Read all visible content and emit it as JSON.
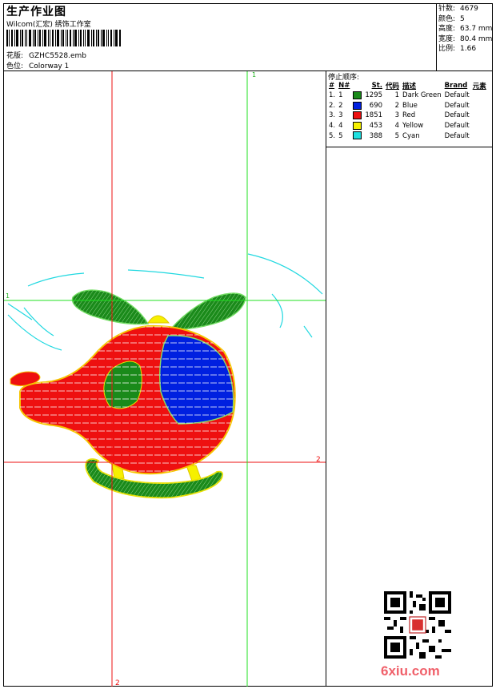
{
  "header": {
    "title": "生产作业图",
    "studio": "Wilcom(汇宏) 绣饰工作室",
    "design_label": "花版:",
    "design_value": "GZHC5528.emb",
    "colorway_label": "色位:",
    "colorway_value": "Colorway 1"
  },
  "stats": {
    "stitches_label": "针数:",
    "stitches_value": "4679",
    "colors_label": "颜色:",
    "colors_value": "5",
    "height_label": "高度:",
    "height_value": "63.7 mm",
    "width_label": "宽度:",
    "width_value": "80.4 mm",
    "ratio_label": "比例:",
    "ratio_value": "1.66"
  },
  "stop_sequence": {
    "title": "停止顺序:",
    "columns": [
      "#",
      "N#",
      "St.",
      "代码",
      "描述",
      "Brand",
      "元素"
    ],
    "rows": [
      {
        "idx": "1.",
        "n": "1",
        "color": "#1a8a1a",
        "st": "1295",
        "code": "1",
        "desc": "Dark Green",
        "brand": "Default"
      },
      {
        "idx": "2.",
        "n": "2",
        "color": "#0020e0",
        "st": "690",
        "code": "2",
        "desc": "Blue",
        "brand": "Default"
      },
      {
        "idx": "3.",
        "n": "3",
        "color": "#ee1010",
        "st": "1851",
        "code": "3",
        "desc": "Red",
        "brand": "Default"
      },
      {
        "idx": "4.",
        "n": "4",
        "color": "#f6f000",
        "st": "453",
        "code": "4",
        "desc": "Yellow",
        "brand": "Default"
      },
      {
        "idx": "5.",
        "n": "5",
        "color": "#20e0e0",
        "st": "388",
        "code": "5",
        "desc": "Cyan",
        "brand": "Default"
      }
    ]
  },
  "design": {
    "marker_green_top": "1",
    "marker_green_left": "1",
    "marker_red_right": "2",
    "marker_red_bottom": "2"
  },
  "watermark": "6xiu.com"
}
